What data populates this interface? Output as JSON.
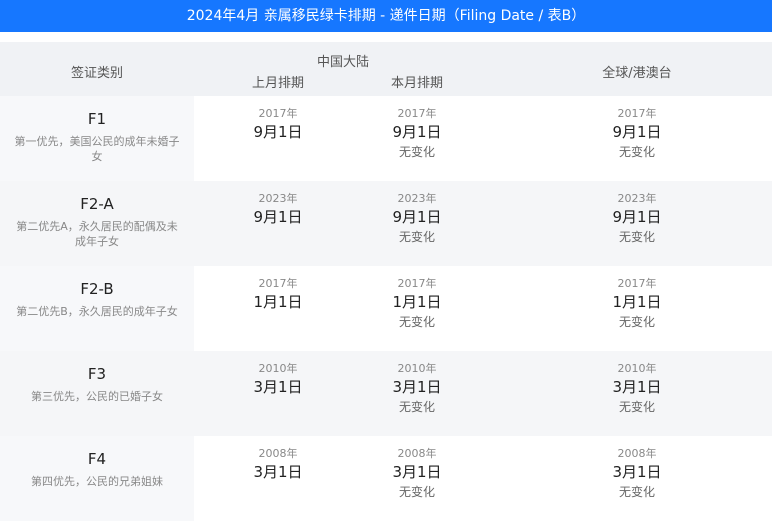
{
  "title": "2024年4月 亲属移民绿卡排期 - 递件日期（Filing Date / 表B）",
  "header": {
    "category": "签证类别",
    "china": "中国大陆",
    "last_month": "上月排期",
    "this_month": "本月排期",
    "global": "全球/港澳台"
  },
  "rows": [
    {
      "code": "F1",
      "desc": "第一优先，美国公民的成年未婚子女",
      "last": {
        "year": "2017年",
        "md": "9月1日"
      },
      "this": {
        "year": "2017年",
        "md": "9月1日",
        "change": "无变化"
      },
      "global": {
        "year": "2017年",
        "md": "9月1日",
        "change": "无变化"
      }
    },
    {
      "code": "F2-A",
      "desc": "第二优先A，永久居民的配偶及未成年子女",
      "last": {
        "year": "2023年",
        "md": "9月1日"
      },
      "this": {
        "year": "2023年",
        "md": "9月1日",
        "change": "无变化"
      },
      "global": {
        "year": "2023年",
        "md": "9月1日",
        "change": "无变化"
      }
    },
    {
      "code": "F2-B",
      "desc": "第二优先B，永久居民的成年子女",
      "last": {
        "year": "2017年",
        "md": "1月1日"
      },
      "this": {
        "year": "2017年",
        "md": "1月1日",
        "change": "无变化"
      },
      "global": {
        "year": "2017年",
        "md": "1月1日",
        "change": "无变化"
      }
    },
    {
      "code": "F3",
      "desc": "第三优先，公民的已婚子女",
      "last": {
        "year": "2010年",
        "md": "3月1日"
      },
      "this": {
        "year": "2010年",
        "md": "3月1日",
        "change": "无变化"
      },
      "global": {
        "year": "2010年",
        "md": "3月1日",
        "change": "无变化"
      }
    },
    {
      "code": "F4",
      "desc": "第四优先，公民的兄弟姐妹",
      "last": {
        "year": "2008年",
        "md": "3月1日"
      },
      "this": {
        "year": "2008年",
        "md": "3月1日",
        "change": "无变化"
      },
      "global": {
        "year": "2008年",
        "md": "3月1日",
        "change": "无变化"
      }
    }
  ]
}
